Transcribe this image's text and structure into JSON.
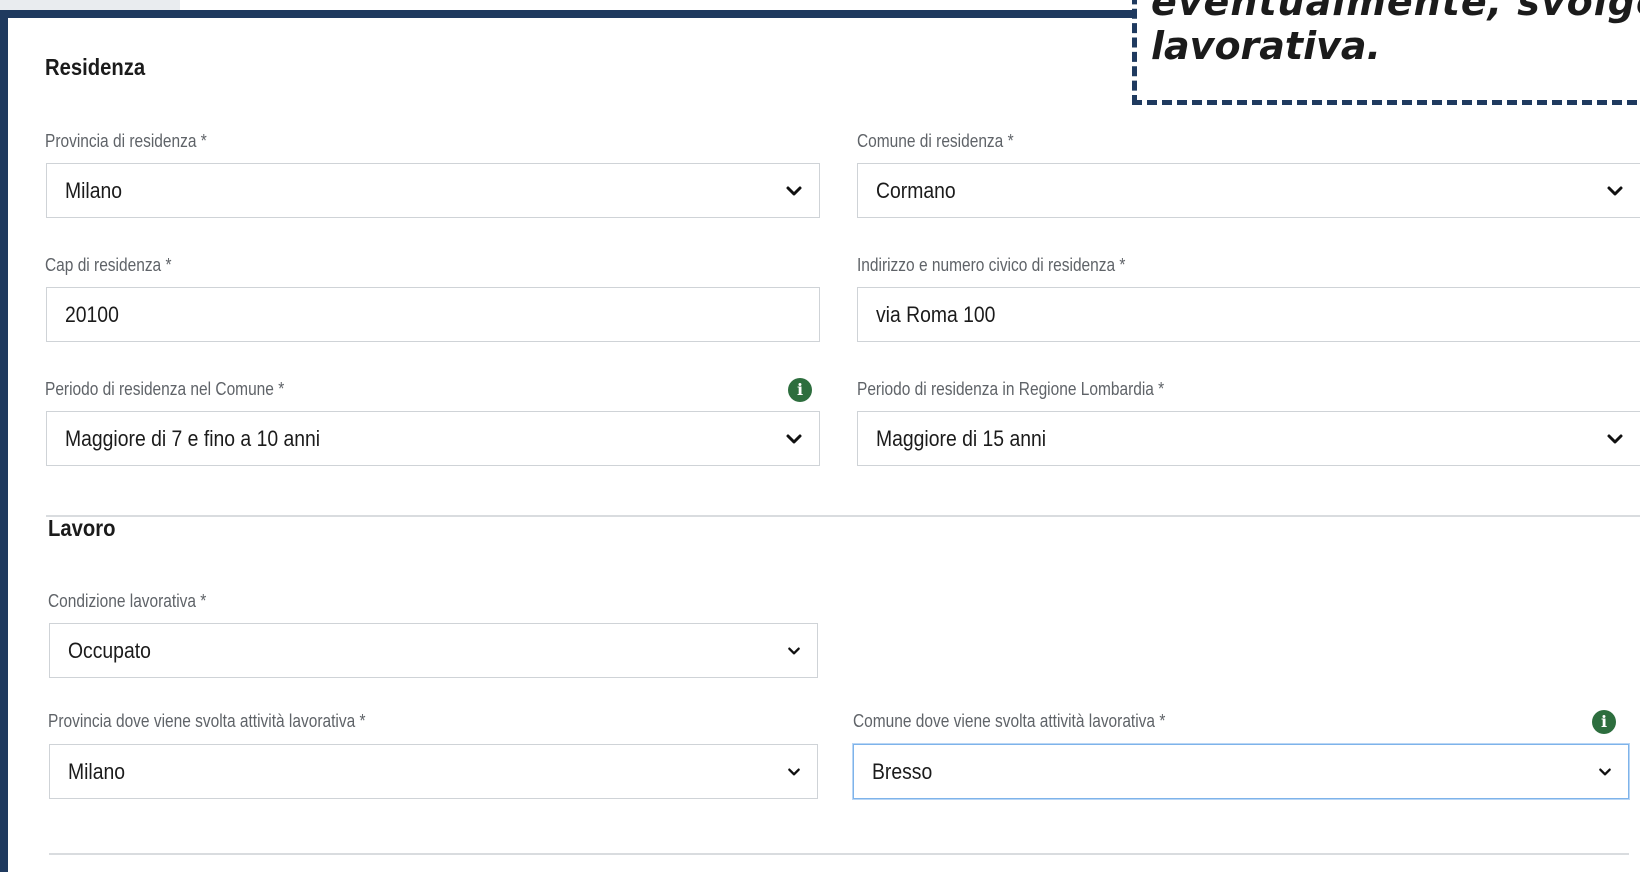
{
  "callout": {
    "line1": "eventualmente,   svolge   a",
    "line2": "lavorativa."
  },
  "residenza": {
    "title": "Residenza",
    "provincia_label": "Provincia di residenza *",
    "provincia_value": "Milano",
    "comune_label": "Comune di residenza *",
    "comune_value": "Cormano",
    "cap_label": "Cap di residenza *",
    "cap_value": "20100",
    "indirizzo_label": "Indirizzo e numero civico di residenza *",
    "indirizzo_value": "via Roma 100",
    "periodo_comune_label": "Periodo di residenza nel Comune *",
    "periodo_comune_value": "Maggiore di 7 e fino a 10 anni",
    "periodo_regione_label": "Periodo di residenza in Regione Lombardia *",
    "periodo_regione_value": "Maggiore di 15 anni"
  },
  "lavoro": {
    "title": "Lavoro",
    "condizione_label": "Condizione lavorativa *",
    "condizione_value": "Occupato",
    "provincia_label": "Provincia dove viene svolta attività lavorativa *",
    "provincia_value": "Milano",
    "comune_label": "Comune dove viene svolta attività lavorativa *",
    "comune_value": "Bresso"
  },
  "icons": {
    "info": "info-circle-icon",
    "chevron": "chevron-down-icon"
  },
  "colors": {
    "frame": "#1f3a5f",
    "info_icon": "#2d6e3e",
    "focus": "#7eb3ea"
  }
}
